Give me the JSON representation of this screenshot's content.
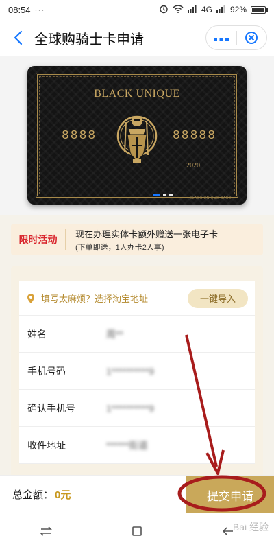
{
  "status_bar": {
    "time": "08:54",
    "dots": "···",
    "network": "4G",
    "battery": "92%",
    "battery_level": 0.92
  },
  "nav": {
    "title": "全球购骑士卡申请",
    "back_icon": "chevron-left-icon",
    "more_icon": "more-dots-icon",
    "close_icon": "close-circle-icon"
  },
  "card": {
    "brand": "BLACK UNIQUE",
    "number_left": "8888",
    "number_right": "88888",
    "year": "2020",
    "small_print": "BLACK UNIQUE CARD",
    "carousel_count": 3,
    "carousel_active": 0
  },
  "promo": {
    "tag": "限时活动",
    "main": "现在办理实体卡额外赠送一张电子卡",
    "sub": "(下单即送，1人办卡2人享)"
  },
  "form": {
    "address_prompt": "填写太麻烦？选择淘宝地址",
    "import_label": "一键导入",
    "fields": [
      {
        "label": "姓名",
        "value": "周**"
      },
      {
        "label": "手机号码",
        "value": "1**********9"
      },
      {
        "label": "确认手机号",
        "value": "1**********9"
      },
      {
        "label": "收件地址",
        "value": "******街道"
      }
    ]
  },
  "footer": {
    "total_label": "总金额：",
    "total_value": "0元",
    "submit_label": "提交申请"
  },
  "watermark": "Bai 经验",
  "colors": {
    "accent_blue": "#1677ff",
    "gold": "#c9a85a",
    "promo_red": "#d9262e",
    "annotation_red": "#a81c1c"
  }
}
